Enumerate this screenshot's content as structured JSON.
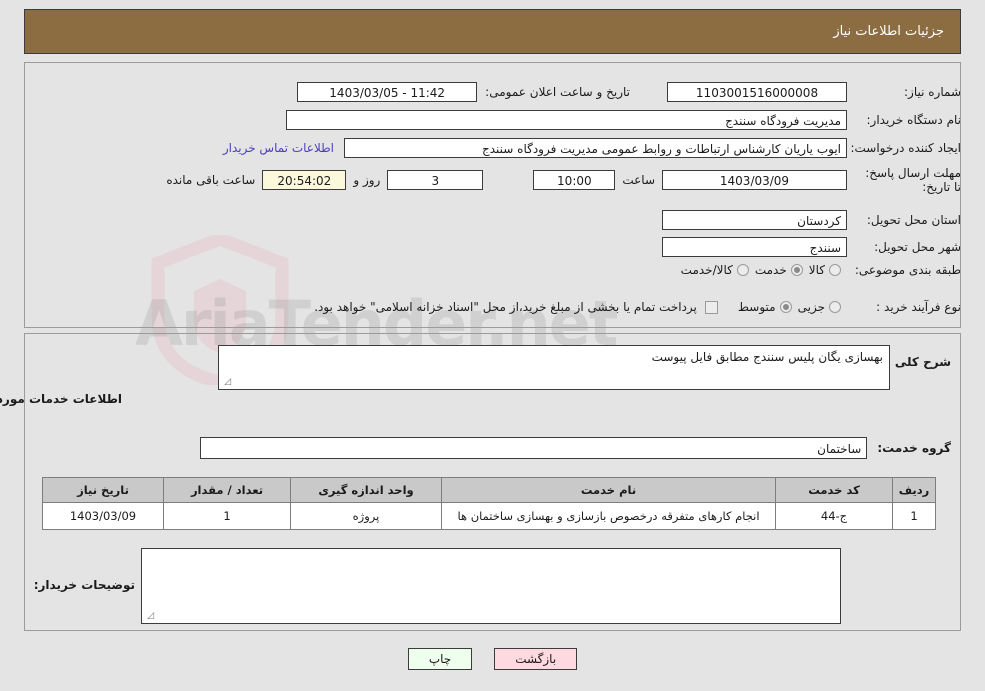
{
  "header": {
    "title": "جزئیات اطلاعات نیاز"
  },
  "watermark": {
    "text": "AriaTender.net",
    "shield_icon": "shield-icon"
  },
  "form": {
    "need_number_label": "شماره نیاز:",
    "need_number_value": "1103001516000008",
    "announce_datetime_label": "تاریخ و ساعت اعلان عمومی:",
    "announce_datetime_value": "11:42 - 1403/03/05",
    "buyer_org_label": "نام دستگاه خریدار:",
    "buyer_org_value": "مدیریت فرودگاه سنندج",
    "creator_label": "ایجاد کننده درخواست:",
    "creator_value": "ایوب یاریان کارشناس ارتباطات و روابط عمومی مدیریت فرودگاه سنندج",
    "contact_link": "اطلاعات تماس خریدار",
    "deadline_label": "مهلت ارسال پاسخ: تا تاریخ:",
    "deadline_date": "1403/03/09",
    "hour_label": "ساعت",
    "deadline_hour": "10:00",
    "days_remaining": "3",
    "days_and_label": "روز و",
    "countdown": "20:54:02",
    "remaining_suffix": "ساعت باقی مانده",
    "province_label": "استان محل تحویل:",
    "province_value": "کردستان",
    "city_label": "شهر محل تحویل:",
    "city_value": "سنندج",
    "category_label": "طبقه بندی موضوعی:",
    "category_options": [
      {
        "label": "کالا",
        "selected": false
      },
      {
        "label": "خدمت",
        "selected": true
      },
      {
        "label": "کالا/خدمت",
        "selected": false
      }
    ],
    "process_label": "نوع فرآیند خرید :",
    "process_options": [
      {
        "label": "جزیی",
        "selected": false
      },
      {
        "label": "متوسط",
        "selected": true
      }
    ],
    "treasury_checkbox_checked": false,
    "treasury_note": "پرداخت تمام یا بخشی از مبلغ خرید،از محل \"اسناد خزانه اسلامی\" خواهد بود."
  },
  "description": {
    "label": "شرح کلی نیاز:",
    "value": "بهسازی یگان پلیس سنندج مطابق فایل پیوست"
  },
  "services_section": {
    "heading": "اطلاعات خدمات مورد نیاز",
    "group_label": "گروه خدمت:",
    "group_value": "ساختمان"
  },
  "table": {
    "columns": [
      "ردیف",
      "کد خدمت",
      "نام خدمت",
      "واحد اندازه گیری",
      "تعداد / مقدار",
      "تاریخ نیاز"
    ],
    "rows": [
      {
        "row": "1",
        "code": "ج-44",
        "name": "انجام کارهای متفرقه درخصوص بازسازی و بهسازی ساختمان ها",
        "unit": "پروژه",
        "quantity": "1",
        "date": "1403/03/09"
      }
    ]
  },
  "buyer_notes": {
    "label": "توضیحات خریدار:",
    "value": ""
  },
  "footer": {
    "back_button": "بازگشت",
    "print_button": "چاپ"
  },
  "colors": {
    "header_brown": "#8c6d42",
    "page_bg": "#e4e4e4",
    "link": "#4b3fbe",
    "countdown_bg": "#fbf8dc",
    "back_btn": "#ffd9e0",
    "print_btn": "#eeffee",
    "table_header": "#c9c9c9"
  }
}
